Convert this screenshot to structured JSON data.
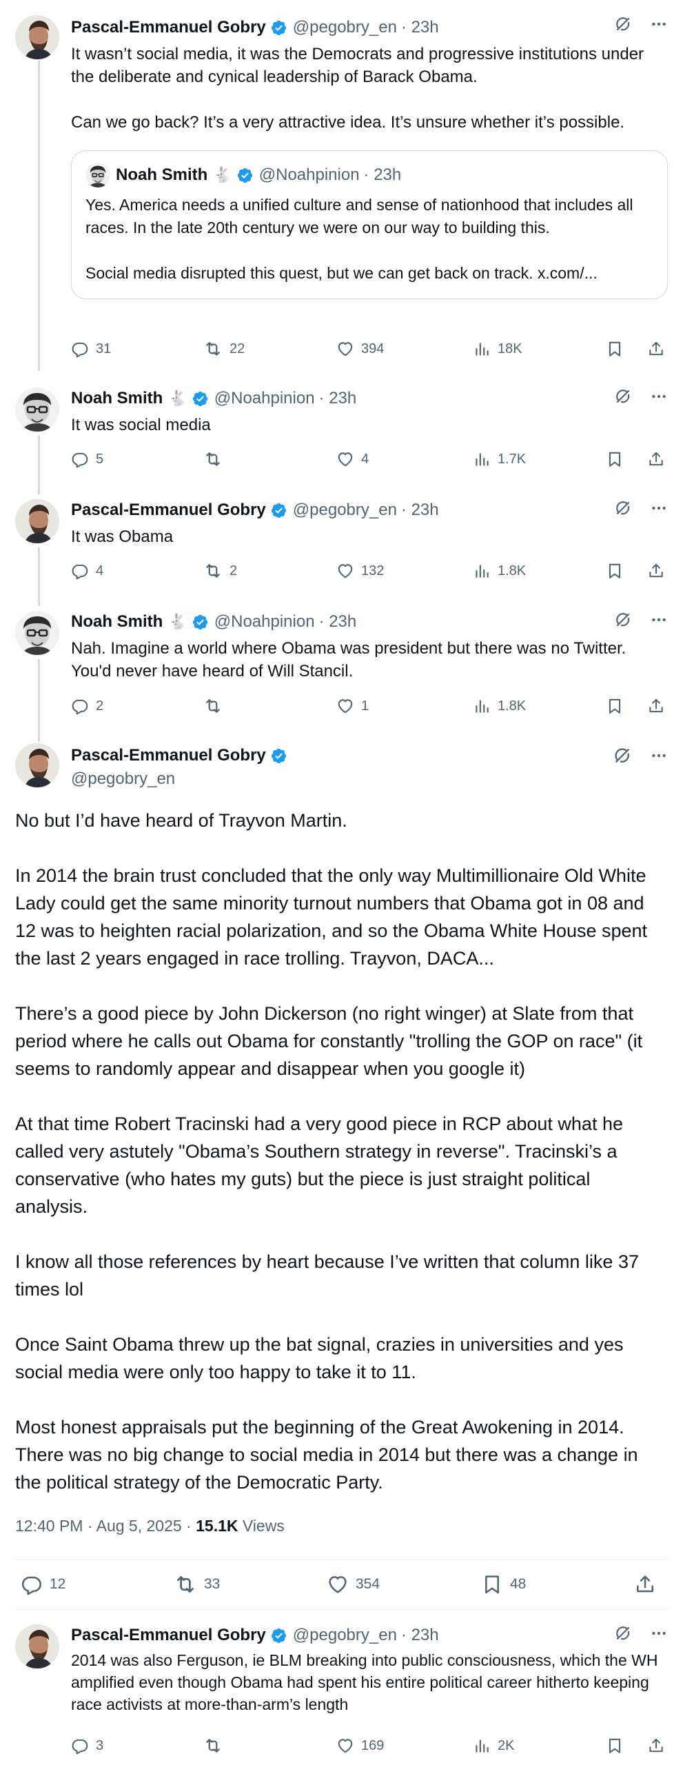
{
  "posts": [
    {
      "name": "Pascal-Emmanuel Gobry",
      "handle": "@pegobry_en",
      "time": "· 23h",
      "text": "It wasn’t social media, it was the Democrats and progressive institutions under the deliberate and cynical leadership of Barack Obama.\n\nCan we go back? It’s a very attractive idea. It’s unsure whether it’s possible.",
      "quote": {
        "name": "Noah Smith",
        "handle": "@Noahpinion",
        "time": "· 23h",
        "text": "Yes. America needs a unified culture and sense of nationhood that includes all races. In the late 20th century we were on our way to building this.\n\nSocial media disrupted this quest, but we can get back on track. x.com/..."
      },
      "replies": "31",
      "reposts": "22",
      "likes": "394",
      "views": "18K"
    },
    {
      "name": "Noah Smith",
      "handle": "@Noahpinion",
      "time": "· 23h",
      "text": "It was social media",
      "replies": "5",
      "reposts": "",
      "likes": "4",
      "views": "1.7K"
    },
    {
      "name": "Pascal-Emmanuel Gobry",
      "handle": "@pegobry_en",
      "time": "· 23h",
      "text": "It was Obama",
      "replies": "4",
      "reposts": "2",
      "likes": "132",
      "views": "1.8K"
    },
    {
      "name": "Noah Smith",
      "handle": "@Noahpinion",
      "time": "· 23h",
      "text": "Nah. Imagine a world where Obama was president but there was no Twitter. You'd never have heard of Will Stancil.",
      "replies": "2",
      "reposts": "",
      "likes": "1",
      "views": "1.8K"
    }
  ],
  "main": {
    "name": "Pascal-Emmanuel Gobry",
    "handle": "@pegobry_en",
    "paragraphs": [
      "No but I’d have heard of Trayvon Martin.",
      "In 2014 the brain trust concluded that the only way Multimillionaire Old White Lady could get the same minority turnout numbers that Obama got in 08 and 12 was to heighten racial polarization, and so the Obama White House spent the last 2 years engaged in race trolling. Trayvon, DACA...",
      "There’s a good piece by John Dickerson (no right winger) at Slate from that period where he calls out Obama for constantly \"trolling the GOP on race\" (it seems to randomly appear and disappear when you google it)",
      "At that time Robert Tracinski had a very good piece in RCP about what he called very astutely \"Obama’s Southern strategy in reverse\". Tracinski’s a conservative (who hates my guts) but the piece is just straight political analysis.",
      "I know all those references by heart because I’ve written that column like 37 times lol",
      "Once Saint Obama threw up the bat signal, crazies in universities and yes social media were only too happy to take it to 11.",
      "Most honest appraisals put the beginning of the Great Awokening in 2014. There was no big change to social media in 2014 but there was a change in the political strategy of the Democratic Party."
    ],
    "timestamp": "12:40 PM · Aug 5, 2025 · ",
    "views_count": "15.1K",
    "views_label": " Views",
    "replies": "12",
    "reposts": "33",
    "likes": "354",
    "bookmarks": "48"
  },
  "reply": {
    "name": "Pascal-Emmanuel Gobry",
    "handle": "@pegobry_en",
    "time": "· 23h",
    "text": "2014 was also Ferguson, ie BLM breaking into public consciousness, which the WH amplified even though Obama had spent his entire political career hitherto keeping race activists at more-than-arm’s length",
    "replies": "3",
    "reposts": "",
    "likes": "169",
    "views": "2K"
  },
  "colors": {
    "verified": "#1d9bf0",
    "muted": "#536471",
    "text": "#0f1419",
    "border": "#cfd9de"
  },
  "icons": [
    "verified-badge-icon",
    "rabbit-emoji",
    "grok-icon",
    "more-icon",
    "reply-icon",
    "repost-icon",
    "like-icon",
    "views-icon",
    "bookmark-icon",
    "share-icon"
  ]
}
